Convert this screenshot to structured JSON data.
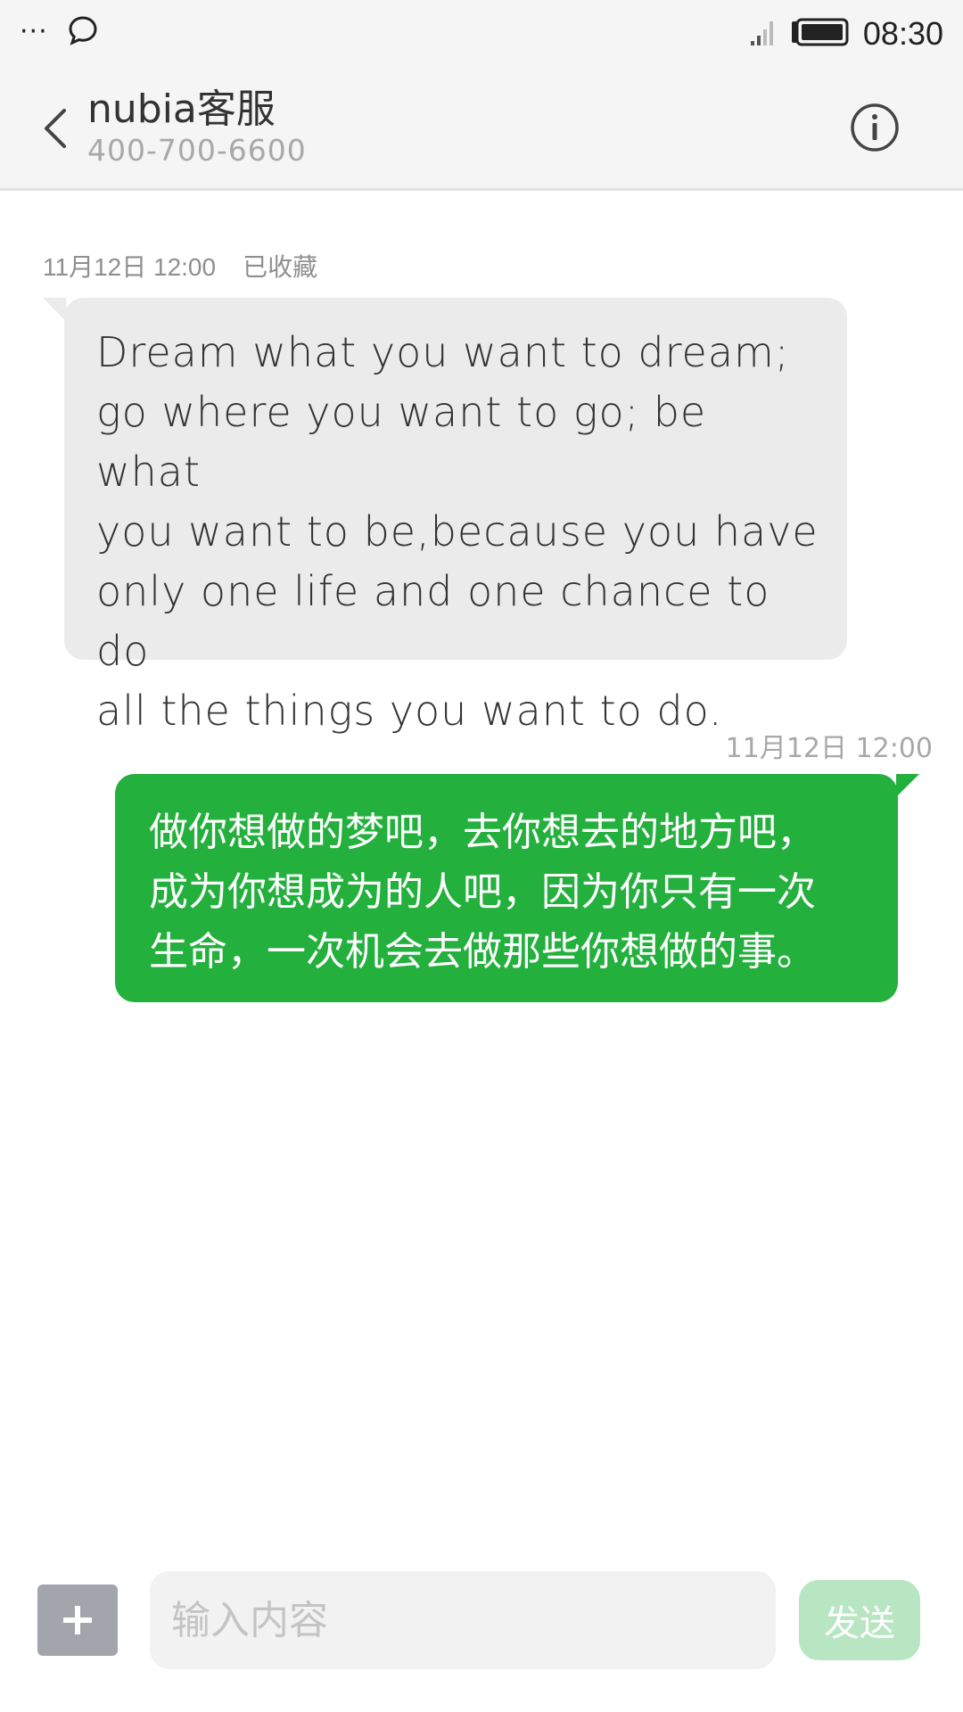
{
  "status_bar": {
    "dots": "···",
    "time": "08:30",
    "icons": [
      "more-dots-icon",
      "chat-bubble-icon",
      "signal-icon",
      "battery-icon"
    ]
  },
  "header": {
    "title": "nubia客服",
    "phone": "400-700-6600",
    "icons": [
      "back-arrow-icon",
      "info-icon"
    ]
  },
  "messages": {
    "incoming": {
      "date": "11月12日 12:00",
      "status": "已收藏",
      "text": "Dream what you want to dream;\ngo where you want to go; be what\nyou want to be,because you have\nonly one life and one chance to do\nall the things you want to do."
    },
    "outgoing": {
      "date": "11月12日  12:00",
      "text": "做你想做的梦吧，去你想去的地方吧，\n成为你想成为的人吧，因为你只有一次\n生命，一次机会去做那些你想做的事。"
    }
  },
  "input_bar": {
    "placeholder": "输入内容",
    "send_label": "发送",
    "add_icon": "plus-icon"
  },
  "colors": {
    "outgoing_bubble": "#23b03d",
    "incoming_bubble": "#ebebeb",
    "send_button_disabled": "#b8e6c2",
    "plus_button": "#a2a6ac"
  }
}
